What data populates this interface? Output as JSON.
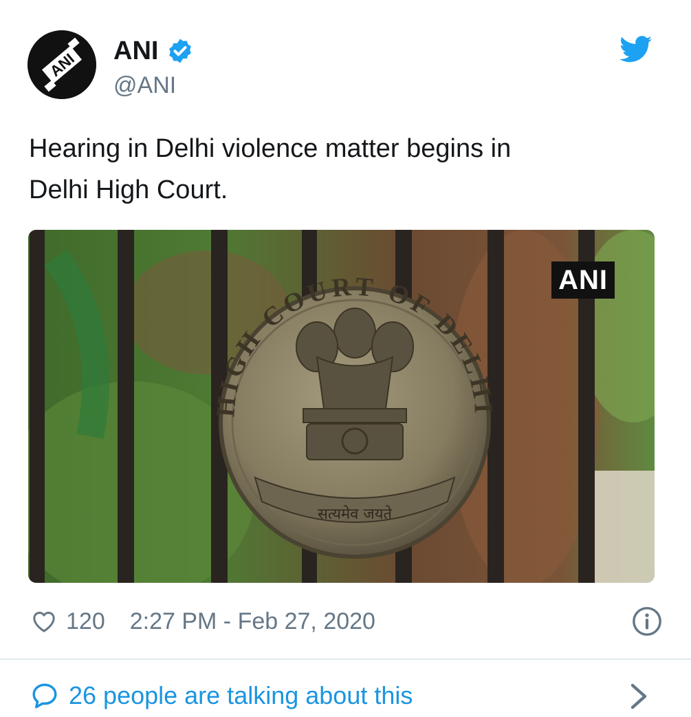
{
  "user": {
    "display_name": "ANI",
    "handle": "@ANI",
    "verified": true,
    "avatar_logo_text": "ANI",
    "avatar_icon": "ani-logo-avatar"
  },
  "tweet": {
    "text_line1": "Hearing in Delhi violence matter begins in",
    "text_line2": "Delhi High Court."
  },
  "media": {
    "watermark": "ANI",
    "seal_text_arc": "HIGH COURT OF DELHI",
    "seal_motto": "सत्यमेव जयते"
  },
  "footer": {
    "like_count": "120",
    "timestamp": "2:27 PM - Feb 27, 2020",
    "talking_text": "26 people are talking about this"
  },
  "icons": {
    "verified": "verified-badge-icon",
    "bird": "twitter-bird-icon",
    "like": "heart-icon",
    "info": "info-icon",
    "comment": "comment-bubble-icon",
    "chevron": "chevron-right-icon"
  },
  "colors": {
    "twitter_blue": "#1da1f2",
    "link_blue": "#1b95e0",
    "text_primary": "#14171a",
    "text_secondary": "#657786",
    "divider": "#e1e8ed"
  }
}
